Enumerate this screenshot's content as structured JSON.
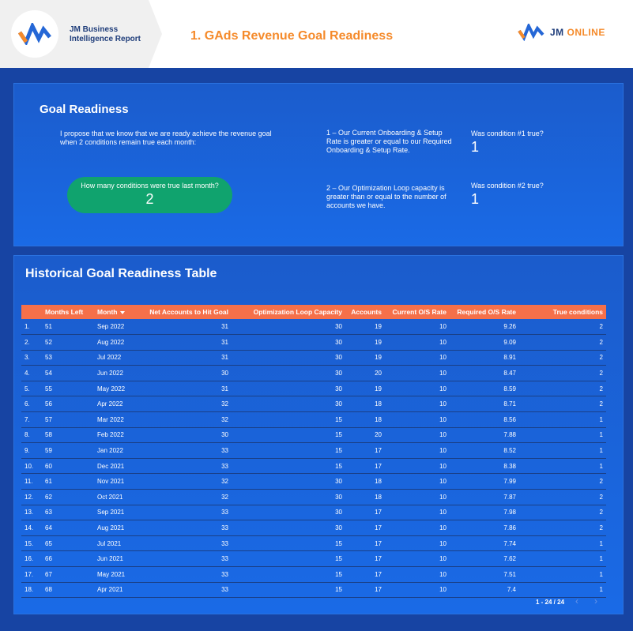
{
  "header": {
    "brand_line1": "JM Business",
    "brand_line2": "Intelligence Report",
    "page_title": "1. GAds Revenue Goal Readiness",
    "jm_logo_jm": "JM",
    "jm_logo_online": "ONLINE",
    "colors": {
      "accent": "#f58a2a",
      "navy": "#1f3d7a",
      "logo_blue": "#2567d6"
    }
  },
  "goal_readiness": {
    "title": "Goal Readiness",
    "intro": "I propose that we know that we are ready achieve the revenue goal when 2 conditions remain true each month:",
    "pill_question": "How many conditions were true last month?",
    "pill_value": "2",
    "condition1_text": "1 – Our Current Onboarding & Setup Rate is greater or equal to our Required Onboarding & Setup Rate.",
    "condition1_question": "Was condition #1 true?",
    "condition1_value": "1",
    "condition2_text": "2 – Our Optimization Loop capacity is greater than or equal to the number of accounts we have.",
    "condition2_question": "Was condition #2 true?",
    "condition2_value": "1"
  },
  "history": {
    "title": "Historical Goal Readiness Table",
    "columns": [
      "Months Left",
      "Month",
      "Net Accounts to Hit Goal",
      "Optimization Loop Capacity",
      "Accounts",
      "Current O/S Rate",
      "Required O/S Rate",
      "True conditions"
    ],
    "rows": [
      [
        "1.",
        "51",
        "Sep 2022",
        "31",
        "30",
        "19",
        "10",
        "9.26",
        "2"
      ],
      [
        "2.",
        "52",
        "Aug 2022",
        "31",
        "30",
        "19",
        "10",
        "9.09",
        "2"
      ],
      [
        "3.",
        "53",
        "Jul 2022",
        "31",
        "30",
        "19",
        "10",
        "8.91",
        "2"
      ],
      [
        "4.",
        "54",
        "Jun 2022",
        "30",
        "30",
        "20",
        "10",
        "8.47",
        "2"
      ],
      [
        "5.",
        "55",
        "May 2022",
        "31",
        "30",
        "19",
        "10",
        "8.59",
        "2"
      ],
      [
        "6.",
        "56",
        "Apr 2022",
        "32",
        "30",
        "18",
        "10",
        "8.71",
        "2"
      ],
      [
        "7.",
        "57",
        "Mar 2022",
        "32",
        "15",
        "18",
        "10",
        "8.56",
        "1"
      ],
      [
        "8.",
        "58",
        "Feb 2022",
        "30",
        "15",
        "20",
        "10",
        "7.88",
        "1"
      ],
      [
        "9.",
        "59",
        "Jan 2022",
        "33",
        "15",
        "17",
        "10",
        "8.52",
        "1"
      ],
      [
        "10.",
        "60",
        "Dec 2021",
        "33",
        "15",
        "17",
        "10",
        "8.38",
        "1"
      ],
      [
        "11.",
        "61",
        "Nov 2021",
        "32",
        "30",
        "18",
        "10",
        "7.99",
        "2"
      ],
      [
        "12.",
        "62",
        "Oct 2021",
        "32",
        "30",
        "18",
        "10",
        "7.87",
        "2"
      ],
      [
        "13.",
        "63",
        "Sep 2021",
        "33",
        "30",
        "17",
        "10",
        "7.98",
        "2"
      ],
      [
        "14.",
        "64",
        "Aug 2021",
        "33",
        "30",
        "17",
        "10",
        "7.86",
        "2"
      ],
      [
        "15.",
        "65",
        "Jul 2021",
        "33",
        "15",
        "17",
        "10",
        "7.74",
        "1"
      ],
      [
        "16.",
        "66",
        "Jun 2021",
        "33",
        "15",
        "17",
        "10",
        "7.62",
        "1"
      ],
      [
        "17.",
        "67",
        "May 2021",
        "33",
        "15",
        "17",
        "10",
        "7.51",
        "1"
      ],
      [
        "18.",
        "68",
        "Apr 2021",
        "33",
        "15",
        "17",
        "10",
        "7.4",
        "1"
      ]
    ],
    "pagination": "1 - 24 / 24",
    "prev_icon": "chevron-left-icon",
    "next_icon": "chevron-right-icon"
  }
}
